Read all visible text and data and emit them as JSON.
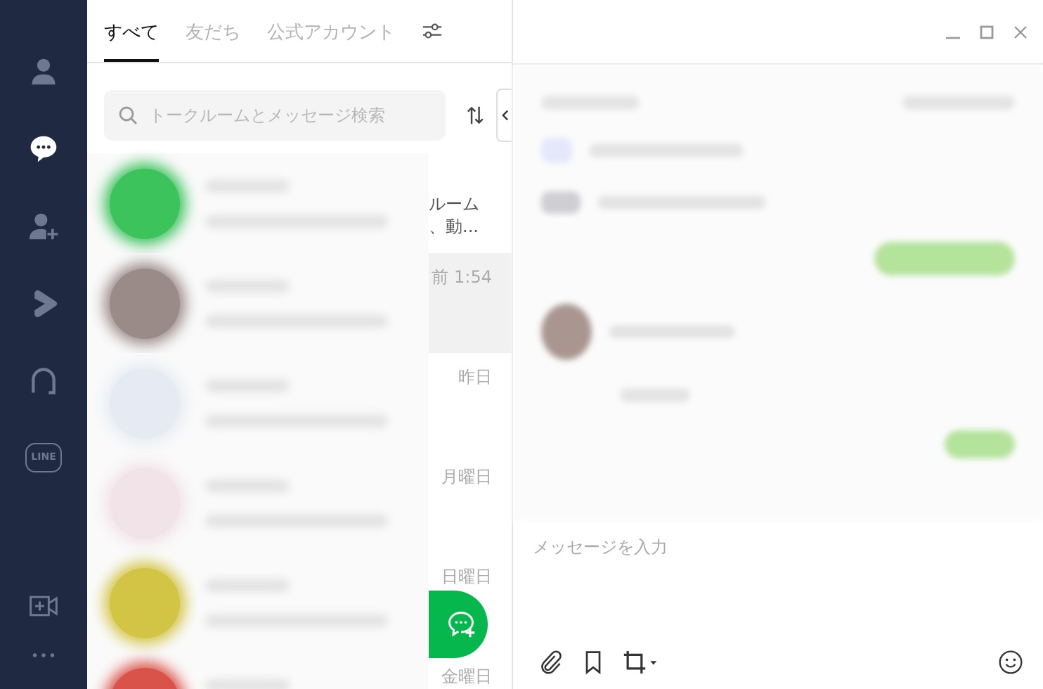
{
  "sidebar": {
    "items": [
      {
        "kind": "profile",
        "selected": false
      },
      {
        "kind": "chats",
        "selected": true
      },
      {
        "kind": "add-friend",
        "selected": false
      },
      {
        "kind": "play",
        "selected": false
      },
      {
        "kind": "arc",
        "selected": false
      },
      {
        "kind": "badge",
        "label": "LINE",
        "selected": false
      }
    ],
    "bottom_items": [
      {
        "kind": "video-add"
      },
      {
        "kind": "more"
      }
    ]
  },
  "tabs": [
    {
      "label": "すべて",
      "selected": true
    },
    {
      "label": "友だち",
      "selected": false
    },
    {
      "label": "公式アカウント",
      "selected": false
    }
  ],
  "search": {
    "placeholder": "トークルームとメッセージ検索"
  },
  "chats": [
    {
      "color": "#3cc35c",
      "selected": false,
      "preview": [
        "ルーム",
        "、動..."
      ]
    },
    {
      "color": "#9a8a88",
      "selected": true,
      "time": "前 1:54"
    },
    {
      "color": "#e6ebf3",
      "selected": false,
      "time": "昨日"
    },
    {
      "color": "#f1e3e7",
      "selected": false,
      "time": "月曜日"
    },
    {
      "color": "#d2c445",
      "selected": false,
      "time": "日曜日"
    },
    {
      "color": "#d9534a",
      "selected": false,
      "time": "金曜日"
    }
  ],
  "composer": {
    "placeholder": "メッセージを入力"
  }
}
